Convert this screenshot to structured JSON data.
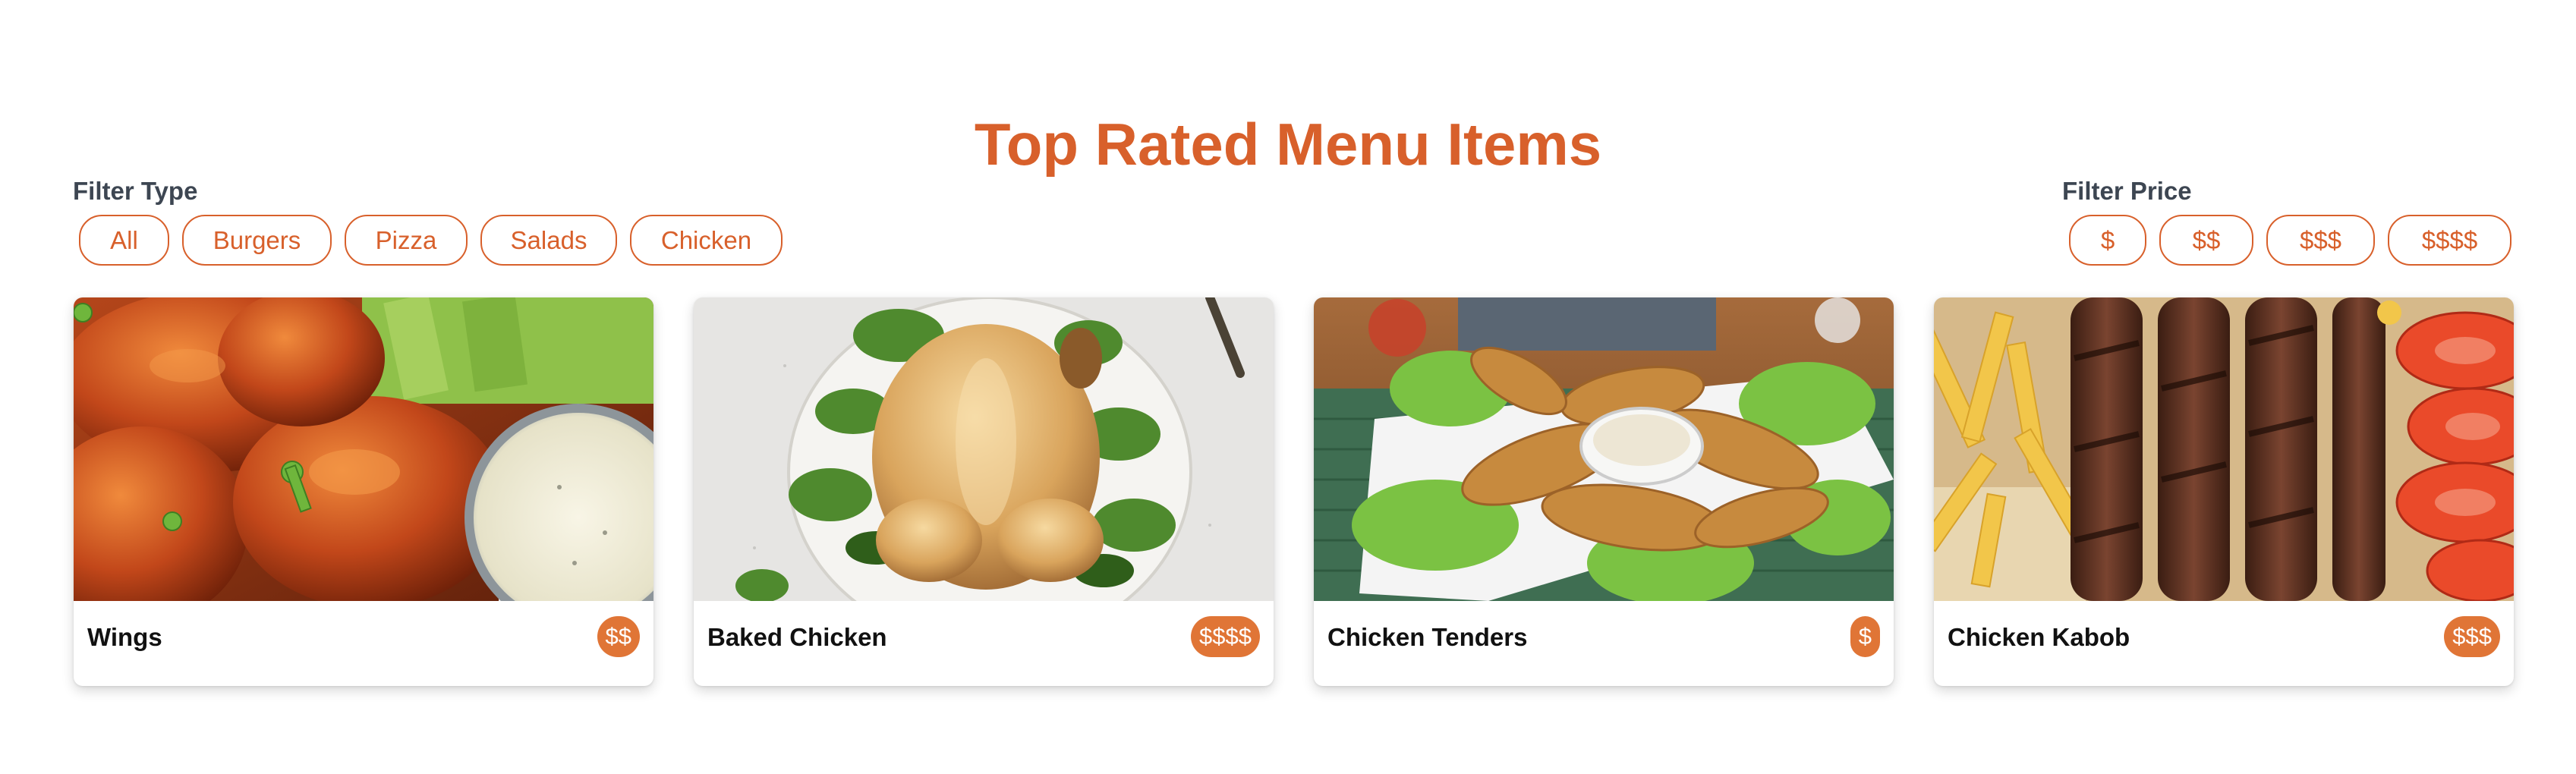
{
  "header": {
    "title": "Top Rated Menu Items"
  },
  "filters": {
    "type_label": "Filter Type",
    "type_options": [
      "All",
      "Burgers",
      "Pizza",
      "Salads",
      "Chicken"
    ],
    "price_label": "Filter Price",
    "price_options": [
      "$",
      "$$",
      "$$$",
      "$$$$"
    ]
  },
  "items": [
    {
      "name": "Wings",
      "price": "$$",
      "image": "chicken-wings-photo"
    },
    {
      "name": "Baked Chicken",
      "price": "$$$$",
      "image": "baked-chicken-photo"
    },
    {
      "name": "Chicken Tenders",
      "price": "$",
      "image": "chicken-tenders-photo"
    },
    {
      "name": "Chicken Kabob",
      "price": "$$$",
      "image": "chicken-kabob-photo"
    }
  ],
  "colors": {
    "accent": "#d8602b",
    "badge": "#e07536",
    "label_text": "#3d4652"
  }
}
